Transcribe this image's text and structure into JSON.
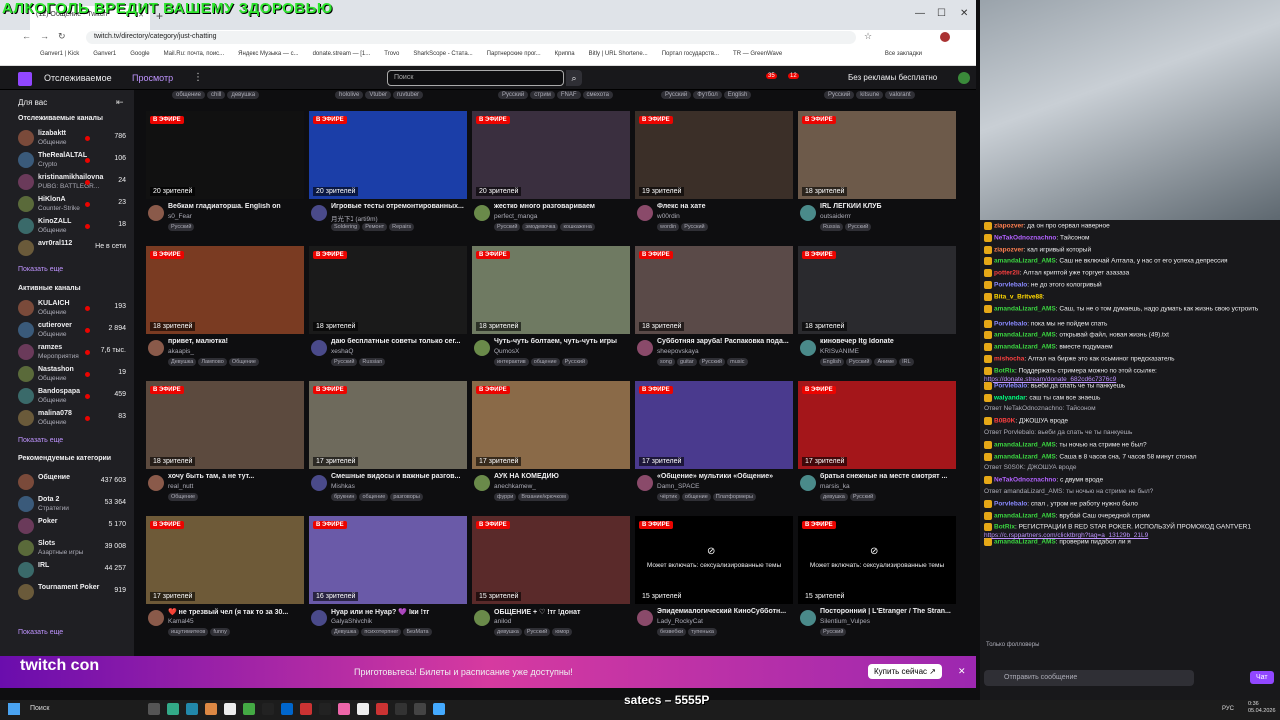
{
  "overlay_top": "АЛКОГОЛЬ ВРЕДИТ ВАШЕМУ ЗДОРОВЬЮ",
  "overlay_bottom": "satecs – 5555P",
  "browser": {
    "tab_title": "(12) Общение - Twitch",
    "url": "twitch.tv/directory/category/just-chatting",
    "bookmarks": [
      "Ganver1 | Kick",
      "Ganver1",
      "Google",
      "Mail.Ru: почта, поис...",
      "Яндекс Музыка — с...",
      "donate.stream — [1...",
      "Trovo",
      "SharkScope - Стата...",
      "Партнерские прог...",
      "Криппа",
      "Bitly | URL Shortene...",
      "Портал государств...",
      "TR — GreenWave"
    ],
    "all_bookmarks": "Все закладки"
  },
  "topnav": {
    "following": "Отслеживаемое",
    "browse": "Просмотр",
    "search_placeholder": "Поиск",
    "badge1": "35",
    "badge2": "12",
    "adfree": "Без рекламы бесплатно"
  },
  "sidebar": {
    "for_you": "Для вас",
    "followed_title": "Отслеживаемые каналы",
    "followed": [
      {
        "name": "lizabaktt",
        "game": "Общение",
        "viewers": "786"
      },
      {
        "name": "TheRealALTAL",
        "game": "Crypto",
        "viewers": "106"
      },
      {
        "name": "kristinamikhailovna",
        "game": "PUBG: BATTLEGR...",
        "viewers": "24"
      },
      {
        "name": "HiKlonA",
        "game": "Counter-Strike",
        "viewers": "23"
      },
      {
        "name": "KinoZALL",
        "game": "Общение",
        "viewers": "18"
      },
      {
        "name": "avr0ral112",
        "game": "",
        "viewers": "Не в сети"
      }
    ],
    "show_more": "Показать еще",
    "active_title": "Активные каналы",
    "active": [
      {
        "name": "KULAICH",
        "game": "Общение",
        "viewers": "193"
      },
      {
        "name": "cutierover",
        "game": "Общение",
        "viewers": "2 894"
      },
      {
        "name": "ramzes",
        "game": "Мероприятия",
        "viewers": "7,6 тыс."
      },
      {
        "name": "Nastashon",
        "game": "Общение",
        "viewers": "19"
      },
      {
        "name": "Bandospapa",
        "game": "Общение",
        "viewers": "459"
      },
      {
        "name": "malina078",
        "game": "Общение",
        "viewers": "83"
      }
    ],
    "cats_title": "Рекомендуемые категории",
    "cats": [
      {
        "name": "Общение",
        "game": "",
        "viewers": "437 603"
      },
      {
        "name": "Dota 2",
        "game": "Стратегии",
        "viewers": "53 364"
      },
      {
        "name": "Poker",
        "game": "",
        "viewers": "5 170"
      },
      {
        "name": "Slots",
        "game": "Азартные игры",
        "viewers": "39 008"
      },
      {
        "name": "IRL",
        "game": "",
        "viewers": "44 257"
      },
      {
        "name": "Tournament Poker",
        "game": "",
        "viewers": "919"
      }
    ]
  },
  "top_tags": [
    [
      "общение",
      "chill",
      "девушка"
    ],
    [
      "hololive",
      "Vtuber",
      "ruvtuber"
    ],
    [
      "Русский",
      "стрим",
      "FNAF",
      "смехота"
    ],
    [
      "Русский",
      "Футбол",
      "English"
    ],
    [
      "Русский",
      "kitsune",
      "valorant"
    ]
  ],
  "live_label": "В ЭФИРЕ",
  "cards": [
    {
      "viewers": "20 зрителей",
      "title": "Вебкам гладиаторша. English on",
      "name": "s0_Fear",
      "tags": [
        "Русский"
      ],
      "color": "#111"
    },
    {
      "viewers": "20 зрителей",
      "title": "Игровые тесты отремонтированных...",
      "name": "月光下ℷ (arti9m)",
      "tags": [
        "Soldering",
        "Ремонт",
        "Repairs"
      ],
      "color": "#1b3ea8"
    },
    {
      "viewers": "20 зрителей",
      "title": "жестко много разговариваем",
      "name": "perfect_manga",
      "tags": [
        "Русский",
        "эмодевочка",
        "кошкажена"
      ],
      "color": "#3a2f3f"
    },
    {
      "viewers": "19 зрителей",
      "title": "Флекс на хате",
      "name": "w00rdin",
      "tags": [
        "wordin",
        "Русский"
      ],
      "color": "#3b2f28"
    },
    {
      "viewers": "18 зрителей",
      "title": "IRL ЛЕГКИЙ КЛУБ",
      "name": "outsaiderrr",
      "tags": [
        "Russia",
        "Русский"
      ],
      "color": "#6d5a4a"
    },
    {
      "viewers": "18 зрителей",
      "title": "привет, малютка!",
      "name": "akaapis_",
      "tags": [
        "Девушка",
        "Ламповo",
        "Общение"
      ],
      "color": "#7a3b22"
    },
    {
      "viewers": "18 зрителей",
      "title": "даю бесплатные советы только сег...",
      "name": "xeshaQ",
      "tags": [
        "Русский",
        "Russian"
      ],
      "color": "#1a1a1a"
    },
    {
      "viewers": "18 зрителей",
      "title": "Чуть-чуть болтаем, чуть-чуть игры",
      "name": "QumosX",
      "tags": [
        "интерактив",
        "общение",
        "Русский"
      ],
      "color": "#6f7a62"
    },
    {
      "viewers": "18 зрителей",
      "title": "Субботняя зарубa! Распаковка пода...",
      "name": "sheepovskaya",
      "tags": [
        "song",
        "guitar",
        "Русский",
        "music"
      ],
      "color": "#5a4a48"
    },
    {
      "viewers": "18 зрителей",
      "title": "киновечер Itg Idonate",
      "name": "KRISvANIME",
      "tags": [
        "English",
        "Русский",
        "Аниме",
        "IRL"
      ],
      "color": "#2a2a2e"
    },
    {
      "viewers": "18 зрителей",
      "title": "хочу быть там, а не тут...",
      "name": "real_nutt",
      "tags": [
        "Общение"
      ],
      "color": "#5c4a3e"
    },
    {
      "viewers": "17 зрителей",
      "title": "Смешные видосы и важные разгов...",
      "name": "Mishkas",
      "tags": [
        "брукнин",
        "общение",
        "разговоры"
      ],
      "color": "#6e6a5c"
    },
    {
      "viewers": "17 зрителей",
      "title": "АУК НА КОМЕДИЮ",
      "name": "anechkamew_",
      "tags": [
        "фурри",
        "Вязание/крючком"
      ],
      "color": "#8a6a48"
    },
    {
      "viewers": "17 зрителей",
      "title": "«Общение» мультики «Общение»",
      "name": "Damn_SPACE",
      "tags": [
        "чёртик",
        "общение",
        "Платформеры"
      ],
      "color": "#4a3a8e"
    },
    {
      "viewers": "17 зрителей",
      "title": "братья снежные на месте смотрят ...",
      "name": "marsis_ka",
      "tags": [
        "девушка",
        "Русский"
      ],
      "color": "#a4161a"
    },
    {
      "viewers": "17 зрителей",
      "title": "❤️ не трезвый чел (я так то за 30...",
      "name": "Kamal45",
      "tags": [
        "ищутимитеов",
        "funny"
      ],
      "color": "#6e5a38"
    },
    {
      "viewers": "16 зрителей",
      "title": "Нуар или не Нуар? 💜 Іки !тг",
      "name": "GalyaShivchik",
      "tags": [
        "Девушка",
        "психотерпнег",
        "БезМата"
      ],
      "color": "#6a5aa8"
    },
    {
      "viewers": "15 зрителей",
      "title": "ОБЩЕНИЕ + ♡ !тг !донат",
      "name": "anilod",
      "tags": [
        "девушка",
        "Русский",
        "юмор"
      ],
      "color": "#5a2a2a"
    },
    {
      "viewers": "15 зрителей",
      "title": "Эпидемиалогический КиноСубботн...",
      "name": "Lady_RockyCat",
      "tags": [
        "безвебки",
        "тупенька"
      ],
      "color": "#000",
      "blurred": true
    },
    {
      "viewers": "15 зрителей",
      "title": "Посторонний | L'Étranger / The Stran...",
      "name": "Silentium_Vulpes",
      "tags": [
        "Русский"
      ],
      "color": "#000",
      "blurred": true
    }
  ],
  "blur_text": "Может включать: сексуализированные темы",
  "promo": {
    "logo": "twitch con",
    "text": "Приготовьтесь! Билеты и расписание уже доступны!",
    "button": "Купить сейчас ↗"
  },
  "chat": {
    "only_followers": "Только фолловеры",
    "input_placeholder": "Отправить сообщение",
    "send": "Чат",
    "messages": [
      {
        "user": "ziapozver",
        "color": "#ff7f50",
        "text": "да он про сервал наверное"
      },
      {
        "user": "NeTakOdnoznachno",
        "color": "#b362ff",
        "text": "Тайсоном"
      },
      {
        "user": "ziapozver",
        "color": "#ff7f50",
        "text": "кал игривый который"
      },
      {
        "user": "amandaLizard_AMS",
        "color": "#3bd641",
        "text": "Саш не включай Алтала, у нас от его успеха депрессия"
      },
      {
        "user": "potter2li",
        "color": "#ff4040",
        "text": "Алтал криптой уже торгует азазаза"
      },
      {
        "user": "Porvlebalo",
        "color": "#8a8aff",
        "text": "не до этого кологривый"
      },
      {
        "user": "Bita_v_Britve88",
        "color": "#ffd700",
        "text": ""
      },
      {
        "user": "amandaLizard_AMS",
        "color": "#3bd641",
        "text": "Саш, ты не о том думаешь, надо думать как жизнь свою устроить"
      },
      {
        "user": "Porvlebalo",
        "color": "#8a8aff",
        "text": "пока мы не пойдем спать"
      },
      {
        "user": "amandaLizard_AMS",
        "color": "#3bd641",
        "text": "открывай файл, новая жизнь (49).txt"
      },
      {
        "user": "amandaLizard_AMS",
        "color": "#3bd641",
        "text": "вместе подумаем"
      },
      {
        "user": "mishocha",
        "color": "#ff4040",
        "text": "Алтал на бирже это как осьминог предсказатель"
      },
      {
        "user": "BotRix",
        "color": "#3bd641",
        "text": "Поддержать стримера можно по этой ссылке: ",
        "link": "https://donate.stream/donate_682cd6c7376c9"
      },
      {
        "user": "Porvlebalo",
        "color": "#8a8aff",
        "text": "вьеби да спать че ты панкуешь"
      },
      {
        "user": "walyandar",
        "color": "#00ff7f",
        "text": "саш ты сам все знаешь"
      },
      {
        "user": "",
        "color": "#adadb8",
        "text": "Ответ NeTakOdnoznachno: Тайсоном"
      },
      {
        "user": "B0B0K",
        "color": "#ff4040",
        "text": "ДЖОШУА вроде"
      },
      {
        "user": "",
        "color": "#adadb8",
        "text": "Ответ Porvlebalo: вьеби да спать че ты панкуешь"
      },
      {
        "user": "amandaLizard_AMS",
        "color": "#3bd641",
        "text": "ты ночью на стриме не был?"
      },
      {
        "user": "amandaLizard_AMS",
        "color": "#3bd641",
        "text": "Саша в 8 часов сна, 7 часов 58 минут стонал"
      },
      {
        "user": "",
        "color": "#adadb8",
        "text": "Ответ S0S0K: ДЖОШУА вроде"
      },
      {
        "user": "NeTakOdnoznachno",
        "color": "#b362ff",
        "text": "с двумя вроде"
      },
      {
        "user": "",
        "color": "#adadb8",
        "text": "Ответ amandaLizard_AMS: ты ночью на стриме не был?"
      },
      {
        "user": "Porvlebalo",
        "color": "#8a8aff",
        "text": "спал , утром не работу нужно было"
      },
      {
        "user": "amandaLizard_AMS",
        "color": "#3bd641",
        "text": "врубай Саш очередной стрим"
      },
      {
        "user": "BotRix",
        "color": "#3bd641",
        "text": "РЕГИСТРАЦИИ В RED STAR POKER. ИСПОЛЬЗУЙ ПРОМОКОД GANTVER1 ",
        "link": "https://c.rsppartners.com/clicktbrgh?tag=a_13129b_21L9"
      },
      {
        "user": "amandaLizard_AMS",
        "color": "#3bd641",
        "text": "проверим пидабол ли я"
      }
    ]
  },
  "taskbar": {
    "search": "Поиск",
    "time": "0:36",
    "date": "05.04.2026",
    "lang": "РУС"
  }
}
